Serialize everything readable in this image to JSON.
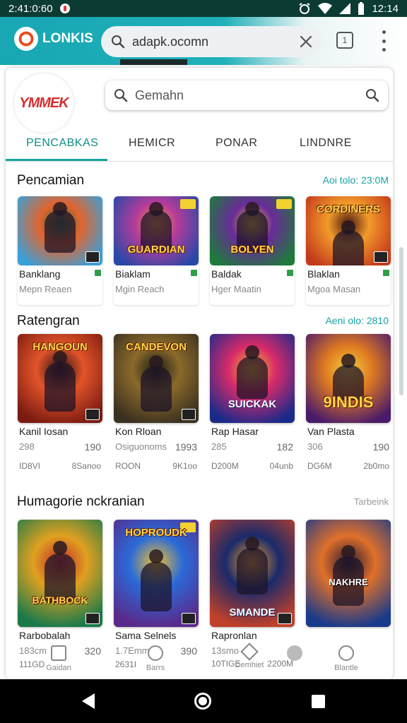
{
  "status_bar": {
    "time": "2:41:0:60",
    "right_time": "12:14",
    "icons": [
      "notification-icon",
      "alarm-icon",
      "wifi-icon",
      "signal-icon",
      "battery-icon"
    ]
  },
  "browser": {
    "brand": "LONKIS",
    "url": "adapk.ocomn",
    "colors": {
      "toolbar": "#18a7b3",
      "status": "#0c3b34"
    }
  },
  "site": {
    "logo_text": "YMMEK",
    "search_placeholder": "Gemahn",
    "tabs": [
      "PENCABKAS",
      "HEMICR",
      "PONAR",
      "LINDNRE"
    ]
  },
  "sections": [
    {
      "title": "Pencamian",
      "meta": "Aoi tolo: 23:0M",
      "items": [
        {
          "name": "Banklang",
          "sub": "Mepn Reaen",
          "art_text": "",
          "colors": [
            "#3aa0d8",
            "#e2642e",
            "#2d6b3a"
          ]
        },
        {
          "name": "Biaklam",
          "sub": "Mgin Reach",
          "art_text": "GUARDIAN",
          "colors": [
            "#2948a8",
            "#b83c9a",
            "#f0a030"
          ]
        },
        {
          "name": "Baldak",
          "sub": "Hger Maatin",
          "art_text": "BOLYEN",
          "colors": [
            "#1f7a3c",
            "#6a2a9a",
            "#e8c430"
          ]
        },
        {
          "name": "Blaklan",
          "sub": "Mgoa Masan",
          "art_text": "CORDINERS",
          "colors": [
            "#c43a1c",
            "#f29a2a",
            "#4a1a10"
          ]
        }
      ]
    },
    {
      "title": "Ratengran",
      "meta": "Aeni olo: 2810",
      "items": [
        {
          "name": "Kanil Iosan",
          "left": "298",
          "right": "190",
          "c1": "ID8VI",
          "c2": "8Sanoo",
          "art_text": "HANGOUN",
          "colors": [
            "#7a1a10",
            "#e2542a",
            "#2a1010"
          ]
        },
        {
          "name": "Kon Rloan",
          "left": "Osiguonoms",
          "right": "1993",
          "c1": "ROON",
          "c2": "9K1oo",
          "art_text": "CANDEVON",
          "colors": [
            "#3a3020",
            "#8a6a2a",
            "#1a1a14"
          ]
        },
        {
          "name": "Rap Hasar",
          "left": "285",
          "right": "182",
          "c1": "D200M",
          "c2": "04unb",
          "art_text": "SUICKAK",
          "colors": [
            "#1a2a8a",
            "#d82a6a",
            "#f0c020"
          ]
        },
        {
          "name": "Van Plasta",
          "left": "306",
          "right": "190",
          "c1": "DG6M",
          "c2": "2b0mo",
          "art_text": "9INDIS",
          "colors": [
            "#4a1a6a",
            "#e07a20",
            "#f0d040"
          ]
        }
      ]
    },
    {
      "title": "Humagorie nckranian",
      "meta": "Tarbeink",
      "items": [
        {
          "name": "Rarbobalah",
          "left": "183cm",
          "right": "320",
          "c1": "111GD",
          "c2": "",
          "art_text": "BATHBOCK",
          "colors": [
            "#1a7a4a",
            "#e0a020",
            "#c02a2a"
          ]
        },
        {
          "name": "Sama Selnels",
          "left": "1.7Emm",
          "right": "390",
          "c1": "2631I",
          "c2": "",
          "art_text": "HOPROUDK",
          "colors": [
            "#5a2a8a",
            "#2a6ad8",
            "#f0c030"
          ]
        },
        {
          "name": "Rapronlan",
          "left": "13smo",
          "right": "",
          "c1": "10TIGE",
          "c2": "2200M",
          "art_text": "SMANDE",
          "colors": [
            "#c0402a",
            "#1a2a6a",
            "#f0a030"
          ]
        },
        {
          "name": "",
          "left": "",
          "right": "",
          "c1": "",
          "c2": "",
          "art_text": "NAKHRE",
          "colors": [
            "#1a3a8a",
            "#e0702a",
            "#2a1a30"
          ]
        }
      ]
    }
  ],
  "bottom_nav": [
    {
      "label": "Gaidan",
      "icon": "home-icon"
    },
    {
      "label": "Barrs",
      "icon": "globe-icon"
    },
    {
      "label": "Demhiet",
      "icon": "tag-icon"
    },
    {
      "label": "",
      "icon": "check-icon"
    },
    {
      "label": "Blantle",
      "icon": "profile-icon"
    }
  ]
}
